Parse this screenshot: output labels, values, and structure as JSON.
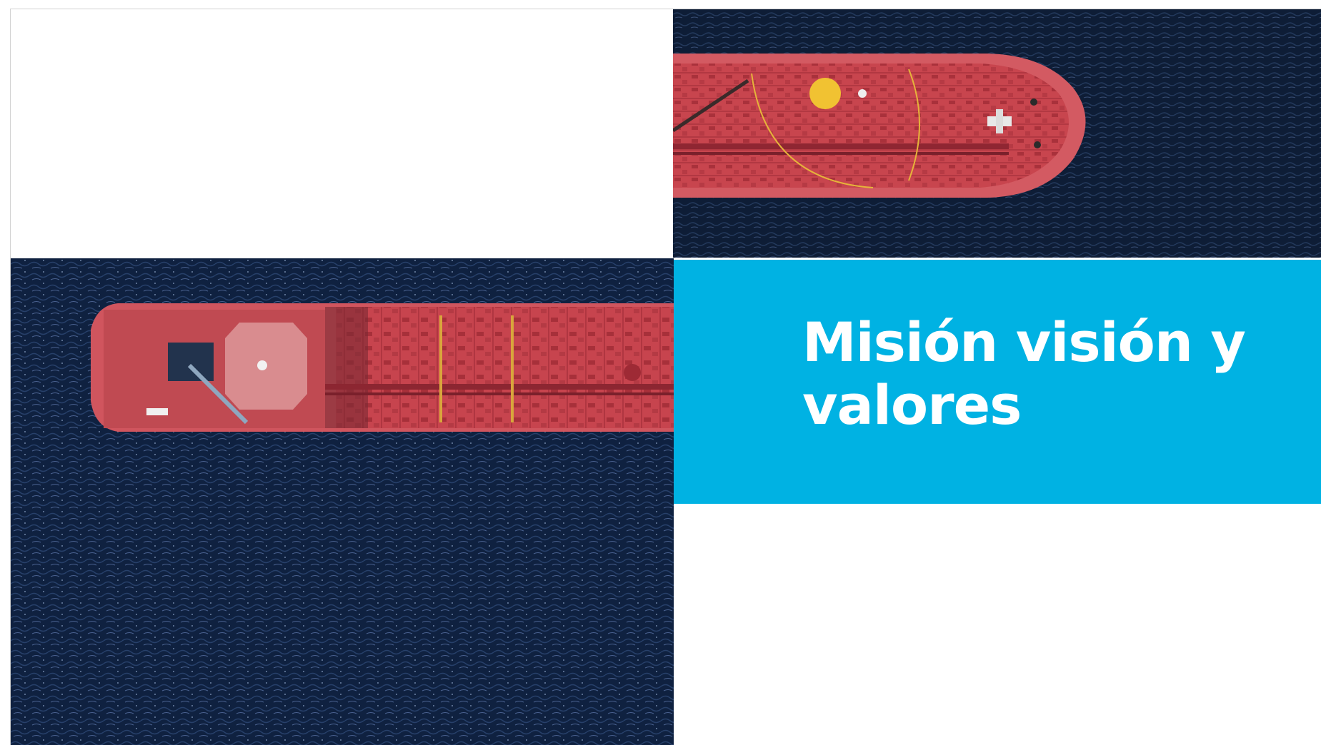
{
  "slide": {
    "title": "Misión visión y valores"
  },
  "colors": {
    "accent": "#00b2e3",
    "sea": "#0f1f38",
    "hull": "#c84b52",
    "deck": "#b8323c",
    "background": "#ffffff"
  },
  "images": [
    {
      "name": "tanker-bow-aerial-photo"
    },
    {
      "name": "tanker-stern-aerial-photo"
    }
  ]
}
